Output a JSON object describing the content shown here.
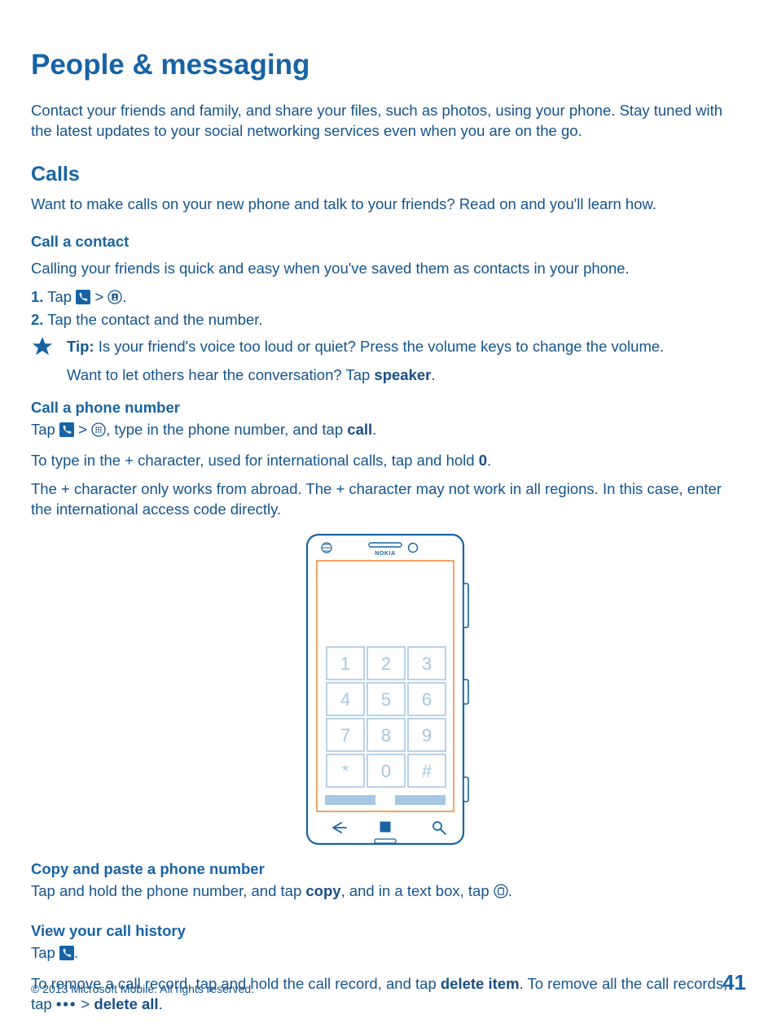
{
  "page": {
    "title": "People & messaging",
    "intro": "Contact your friends and family, and share your files, such as photos, using your phone. Stay tuned with the latest updates to your social networking services even when you are on the go."
  },
  "calls": {
    "heading": "Calls",
    "intro": "Want to make calls on your new phone and talk to your friends? Read on and you'll learn how."
  },
  "call_contact": {
    "heading": "Call a contact",
    "intro": "Calling your friends is quick and easy when you've saved them as contacts in your phone.",
    "step1_num": "1.",
    "step1_a": "Tap ",
    "step1_gt": " > ",
    "step1_end": ".",
    "step2_num": "2.",
    "step2": " Tap the contact and the number.",
    "tip_label": "Tip: ",
    "tip1": "Is your friend's voice too loud or quiet? Press the volume keys to change the volume.",
    "tip2_a": "Want to let others hear the conversation? Tap ",
    "tip2_b": "speaker",
    "tip2_c": "."
  },
  "call_number": {
    "heading": "Call a phone number",
    "line1_a": "Tap ",
    "line1_gt": " > ",
    "line1_b": ", type in the phone number, and tap ",
    "line1_call": "call",
    "line1_c": ".",
    "line2_a": "To type in the + character, used for international calls, tap and hold ",
    "line2_zero": "0",
    "line2_b": ".",
    "line3": "The + character only works from abroad. The + character may not work in all regions. In this case, enter the international access code directly."
  },
  "phone": {
    "brand": "NOKIA",
    "keys": [
      "1",
      "2",
      "3",
      "4",
      "5",
      "6",
      "7",
      "8",
      "9",
      "*",
      "0",
      "#"
    ]
  },
  "copy": {
    "heading": "Copy and paste a phone number",
    "line_a": "Tap and hold the phone number, and tap ",
    "line_copy": "copy",
    "line_b": ", and in a text box, tap ",
    "line_c": "."
  },
  "history": {
    "heading": "View your call history",
    "tap_a": "Tap ",
    "tap_b": ".",
    "remove_a": "To remove a call record, tap and hold the call record, and tap ",
    "remove_del": "delete item",
    "remove_b": ". To remove all the call records, tap  ",
    "remove_gt": " > ",
    "remove_all": "delete all",
    "remove_c": "."
  },
  "footer": {
    "copyright": "© 2013 Microsoft Mobile. All rights reserved.",
    "page": "41"
  },
  "icons": {
    "phone_tile": "phone-tile-icon",
    "contacts_circle": "contacts-circle-icon",
    "dialpad_circle": "dialpad-circle-icon",
    "paste_circle": "paste-circle-icon",
    "star": "star-icon"
  }
}
